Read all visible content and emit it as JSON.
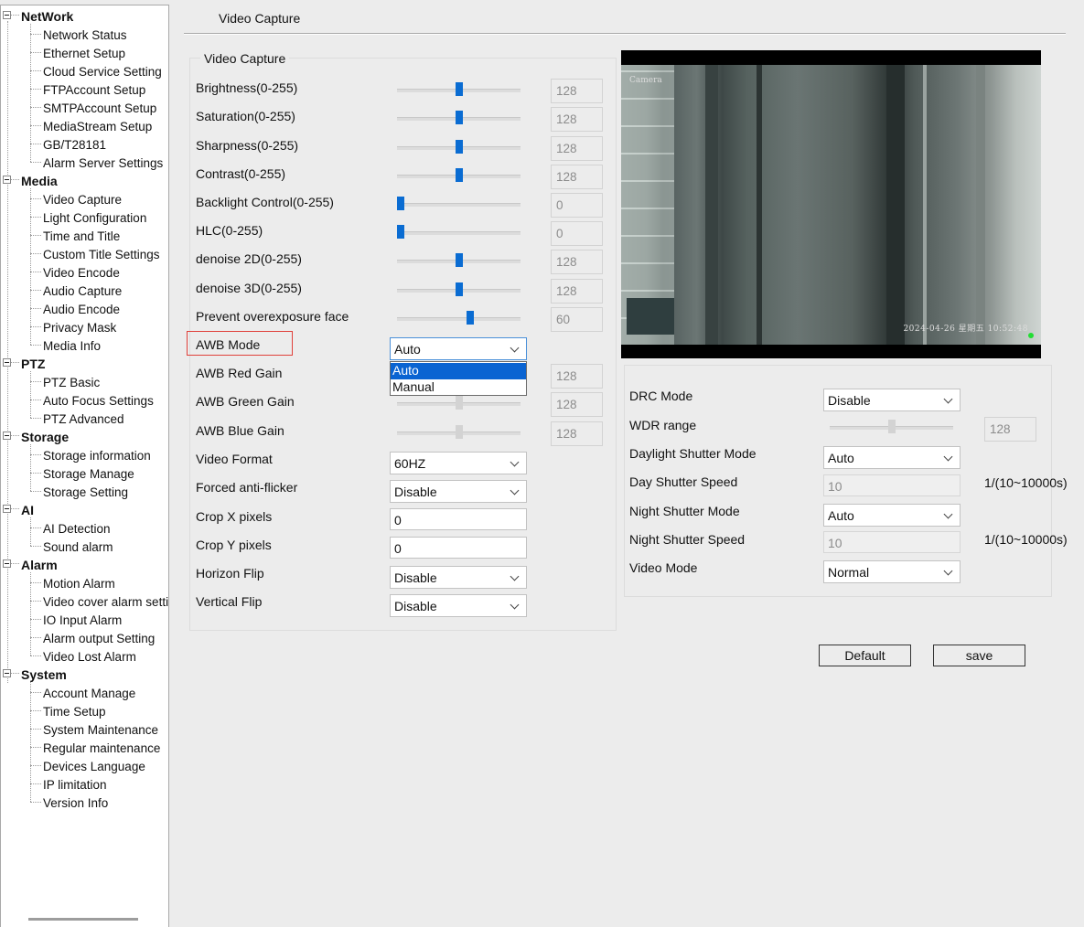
{
  "sidebar": {
    "groups": [
      {
        "label": "NetWork",
        "items": [
          "Network Status",
          "Ethernet Setup",
          "Cloud Service Setting",
          "FTPAccount Setup",
          "SMTPAccount Setup",
          "MediaStream Setup",
          "GB/T28181",
          "Alarm Server Settings"
        ]
      },
      {
        "label": "Media",
        "items": [
          "Video Capture",
          "Light Configuration",
          "Time and Title",
          "Custom Title Settings",
          "Video Encode",
          "Audio Capture",
          "Audio Encode",
          "Privacy Mask",
          "Media Info"
        ]
      },
      {
        "label": "PTZ",
        "items": [
          "PTZ Basic",
          "Auto Focus Settings",
          "PTZ Advanced"
        ]
      },
      {
        "label": "Storage",
        "items": [
          "Storage information",
          "Storage Manage",
          "Storage Setting"
        ]
      },
      {
        "label": "AI",
        "items": [
          "AI Detection",
          "Sound alarm"
        ]
      },
      {
        "label": "Alarm",
        "items": [
          "Motion Alarm",
          "Video cover alarm setti",
          "IO Input Alarm",
          "Alarm output Setting",
          "Video Lost Alarm"
        ]
      },
      {
        "label": "System",
        "items": [
          "Account Manage",
          "Time Setup",
          "System Maintenance",
          "Regular maintenance",
          "Devices Language",
          "IP limitation",
          "Version Info"
        ]
      }
    ]
  },
  "page": {
    "title": "Video Capture",
    "section_legend": "Video Capture"
  },
  "sliders": [
    {
      "label": "Brightness(0-255)",
      "value": "128",
      "level": 128,
      "disabled": false
    },
    {
      "label": "Saturation(0-255)",
      "value": "128",
      "level": 128,
      "disabled": false
    },
    {
      "label": "Sharpness(0-255)",
      "value": "128",
      "level": 128,
      "disabled": false
    },
    {
      "label": "Contrast(0-255)",
      "value": "128",
      "level": 128,
      "disabled": false
    },
    {
      "label": "Backlight Control(0-255)",
      "value": "0",
      "level": 0,
      "disabled": false
    },
    {
      "label": "HLC(0-255)",
      "value": "0",
      "level": 0,
      "disabled": false
    },
    {
      "label": "denoise 2D(0-255)",
      "value": "128",
      "level": 128,
      "disabled": false
    },
    {
      "label": "denoise 3D(0-255)",
      "value": "128",
      "level": 128,
      "disabled": false
    },
    {
      "label": "Prevent overexposure face",
      "value": "60",
      "level": 60,
      "range": [
        0,
        100
      ],
      "disabled": false
    }
  ],
  "awb": {
    "mode_label": "AWB Mode",
    "mode_value": "Auto",
    "options": [
      "Auto",
      "Manual"
    ],
    "gains": [
      {
        "label": "AWB Red Gain",
        "value": "128",
        "level": 128
      },
      {
        "label": "AWB Green Gain",
        "value": "128",
        "level": 128
      },
      {
        "label": "AWB Blue Gain",
        "value": "128",
        "level": 128
      }
    ]
  },
  "left_fields": {
    "video_format": {
      "label": "Video Format",
      "value": "60HZ"
    },
    "anti_flicker": {
      "label": "Forced anti-flicker",
      "value": "Disable"
    },
    "crop_x": {
      "label": "Crop X pixels",
      "value": "0"
    },
    "crop_y": {
      "label": "Crop Y pixels",
      "value": "0"
    },
    "horizon_flip": {
      "label": "Horizon Flip",
      "value": "Disable"
    },
    "vertical_flip": {
      "label": "Vertical Flip",
      "value": "Disable"
    }
  },
  "preview": {
    "osd_top_left": "Camera",
    "osd_bottom_right": "2024-04-26  星期五  10:52:48"
  },
  "right_fields": {
    "drc_mode": {
      "label": "DRC Mode",
      "value": "Disable"
    },
    "wdr_range": {
      "label": "WDR range",
      "value": "128",
      "level": 128
    },
    "daylight_shutter_mode": {
      "label": "Daylight Shutter Mode",
      "value": "Auto"
    },
    "day_shutter_speed": {
      "label": "Day Shutter Speed",
      "value": "10",
      "unit": "1/(10~10000s)"
    },
    "night_shutter_mode": {
      "label": "Night Shutter Mode",
      "value": "Auto"
    },
    "night_shutter_speed": {
      "label": "Night Shutter Speed",
      "value": "10",
      "unit": "1/(10~10000s)"
    },
    "video_mode": {
      "label": "Video Mode",
      "value": "Normal"
    }
  },
  "buttons": {
    "default": "Default",
    "save": "save"
  },
  "colors": {
    "accent": "#0a6cd2",
    "highlight_border": "#e0403a",
    "selected_option": "#0a64d2"
  }
}
